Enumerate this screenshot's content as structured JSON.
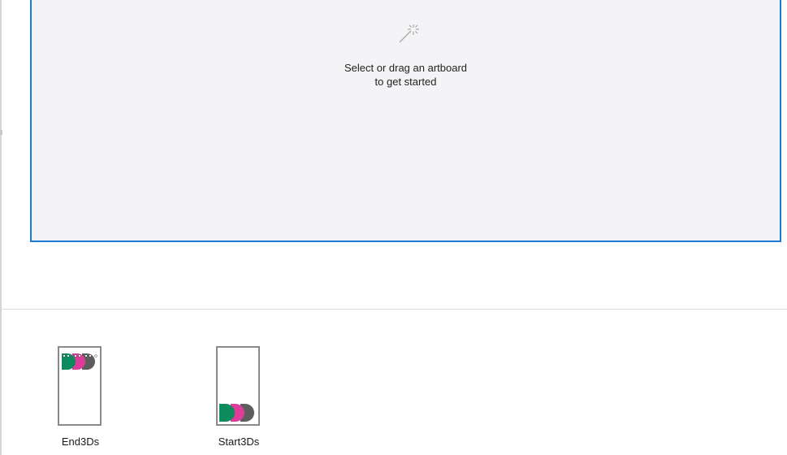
{
  "dropzone": {
    "icon": "magic-wand-icon",
    "hint_line1": "Select or drag an artboard",
    "hint_line2": "to get started",
    "accent_color": "#1b7ad4"
  },
  "artboards": [
    {
      "label": "End3Ds",
      "icon": "three-ds-characters-top"
    },
    {
      "label": "Start3Ds",
      "icon": "three-ds-characters-bottom"
    }
  ],
  "colors": {
    "green": "#0e8a5f",
    "pink": "#dd3d98",
    "gray": "#5d5d5d"
  }
}
